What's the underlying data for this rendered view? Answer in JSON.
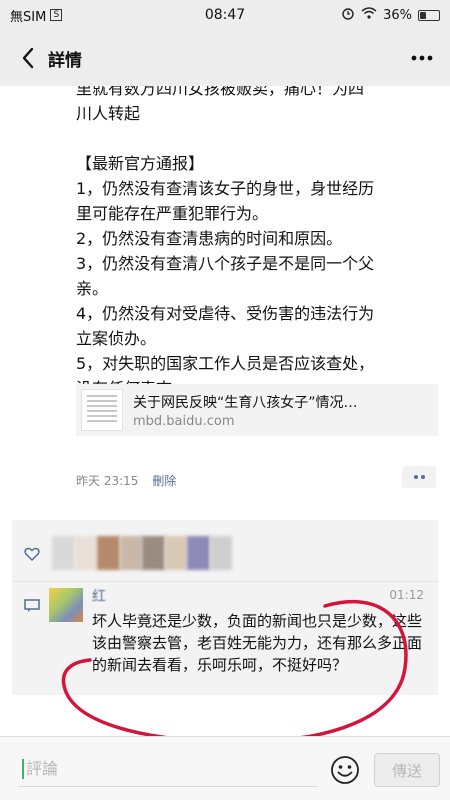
{
  "status_bar": {
    "carrier": "無SIM",
    "time": "08:47",
    "battery": "36%",
    "battery_level": 0.36
  },
  "nav": {
    "title": "詳情"
  },
  "post": {
    "lines": [
      "里就有数万四川女孩被贩卖，痛心！为四",
      "川人转起",
      "",
      "【最新官方通报】",
      "1，仍然没有查清该女子的身世，身世经历",
      "里可能存在严重犯罪行为。",
      "2，仍然没有查清患病的时间和原因。",
      "3，仍然没有查清八个孩子是不是同一个父",
      "亲。",
      "4，仍然没有对受虐待、受伤害的违法行为",
      "立案侦办。",
      "5，对失职的国家工作人员是否应该查处，",
      "没有任何表态。"
    ],
    "link": {
      "title": "关于网民反映“生育八孩女子”情况…",
      "domain": "mbd.baidu.com"
    },
    "time": "昨天 23:15",
    "delete_label": "刪除"
  },
  "comments": [
    {
      "name": "红",
      "time": "01:12",
      "text": "坏人毕竟还是少数，负面的新闻也只是少数，这些该由警察去管，老百姓无能为力，还有那么多正面的新闻去看看，乐呵乐呵，不挺好吗？"
    }
  ],
  "input": {
    "placeholder": "評論",
    "send_label": "傳送"
  },
  "colors": {
    "link_blue": "#576b95",
    "annotation_red": "#d4143a"
  }
}
